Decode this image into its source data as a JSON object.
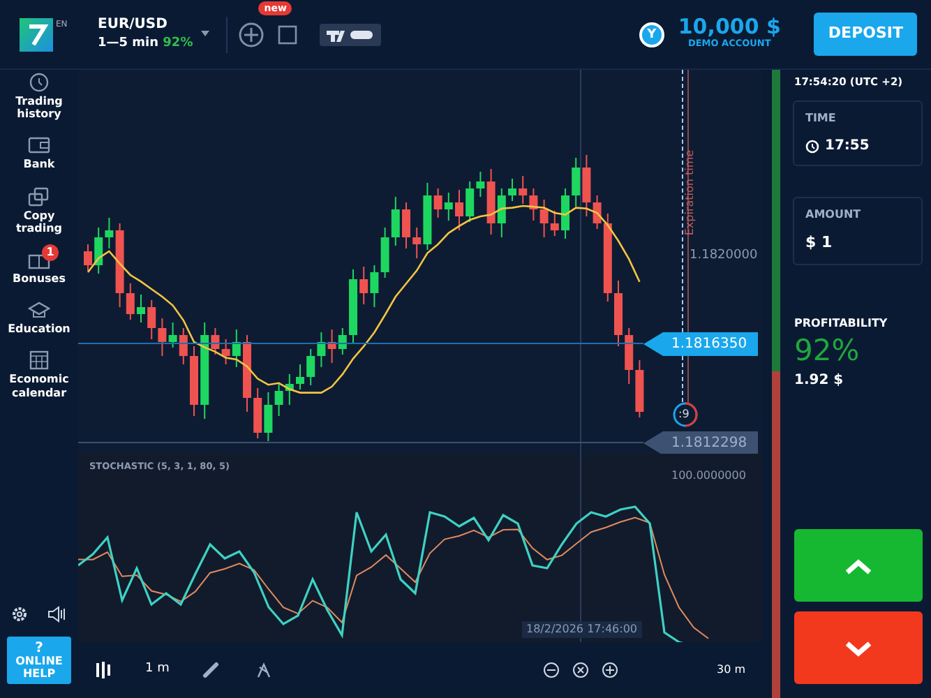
{
  "header": {
    "logo_badge": "EN",
    "asset": "EUR/USD",
    "duration": "1—5 min",
    "payout": "92%",
    "new_badge": "new",
    "avatar_letter": "Y",
    "balance": "10,000 $",
    "account": "DEMO ACCOUNT",
    "deposit": "DEPOSIT"
  },
  "sidebar": {
    "items": [
      {
        "kind": "clock",
        "label": "Trading history"
      },
      {
        "kind": "wallet",
        "label": "Bank"
      },
      {
        "kind": "copy",
        "label": "Copy trading"
      },
      {
        "kind": "gift",
        "label": "Bonuses",
        "badge": "1"
      },
      {
        "kind": "cap",
        "label": "Education"
      },
      {
        "kind": "calendar",
        "label": "Economic calendar"
      }
    ],
    "help": {
      "icon": "?",
      "label": "ONLINE HELP"
    }
  },
  "chart": {
    "price_tick": "1.1820000",
    "current_price": "1.1816350",
    "open_price": "1.1812298",
    "expiration_label": "Expiration time",
    "timer": ":9",
    "indicator": "STOCHASTIC (5, 3, 1, 80, 5)",
    "indicator_tick": "100.0000000",
    "crosshair_time": "18/2/2026 17:46:00"
  },
  "toolbar": {
    "timeframe": "1 m",
    "zoom_range": "30 m"
  },
  "trader_sentiment": {
    "level": 0.48
  },
  "panel": {
    "server_time": "17:54:20 (UTC +2)",
    "time_label": "TIME",
    "time_value": "17:55",
    "amount_label": "AMOUNT",
    "amount_value": "$ 1",
    "profit_label": "PROFITABILITY",
    "profit_percent": "92%",
    "profit_value": "1.92 $"
  }
}
